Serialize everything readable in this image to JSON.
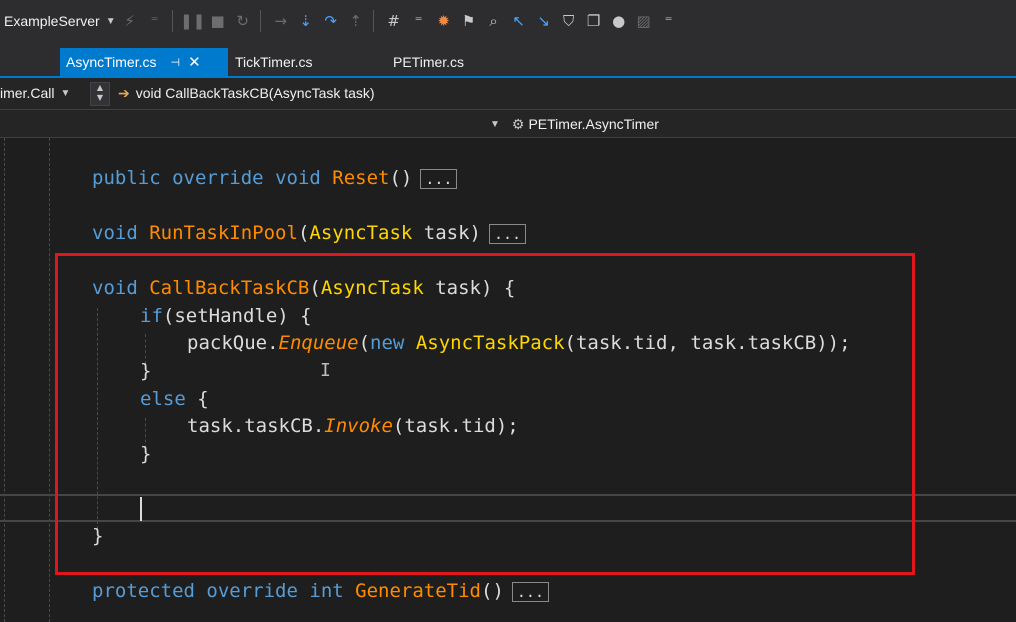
{
  "toolbar": {
    "project_name": "ExampleServer",
    "icons": [
      "step-over-icon",
      "pause-icon",
      "stop-icon",
      "restart-icon",
      "show-next-statement-icon",
      "step-into-icon",
      "step-over2-icon",
      "step-out-icon",
      "hex-icon",
      "threads-icon",
      "breakpoints-icon",
      "call-stack-icon",
      "find-icon",
      "navigate-back-icon",
      "navigate-forward-icon",
      "bookmark-icon",
      "window-icon",
      "settings-icon",
      "more-icon"
    ]
  },
  "tabs": [
    {
      "label": "AsyncTimer.cs",
      "active": true
    },
    {
      "label": "TickTimer.cs",
      "active": false
    },
    {
      "label": "PETimer.cs",
      "active": false
    }
  ],
  "nav": {
    "member_combo": "imer.Call",
    "method_combo": "void CallBackTaskCB(AsyncTask task)",
    "class_combo": "PETimer.AsyncTimer"
  },
  "code": {
    "reset": {
      "kw1": "public",
      "kw2": "override",
      "kw3": "void",
      "name": "Reset",
      "rest": "()",
      "collapsed": "..."
    },
    "run": {
      "kw": "void",
      "name": "RunTaskInPool",
      "open": "(",
      "type": "AsyncTask",
      "rest": " task)",
      "collapsed": "..."
    },
    "cb": {
      "kw": "void",
      "name": "CallBackTaskCB",
      "open": "(",
      "type": "AsyncTask",
      "rest": " task) {"
    },
    "if_line": {
      "kw": "if",
      "rest": "(setHandle) {"
    },
    "enqueue": {
      "pre": "packQue.",
      "method": "Enqueue",
      "open": "(",
      "kw": "new",
      "type": "AsyncTaskPack",
      "rest": "(task.tid, task.taskCB));"
    },
    "close1": "}",
    "else_line": {
      "kw": "else",
      "rest": " {"
    },
    "invoke": {
      "pre": "task.taskCB.",
      "method": "Invoke",
      "rest": "(task.tid);"
    },
    "close2": "}",
    "close3": "}",
    "gen": {
      "kw1": "protected",
      "kw2": "override",
      "kw3": "int",
      "name": "GenerateTid",
      "rest": "()",
      "collapsed": "..."
    }
  },
  "colors": {
    "keyword": "#569cd6",
    "method": "#ff8c00",
    "type": "#ffd700",
    "highlight": "#e0161c",
    "accent": "#007acc"
  }
}
